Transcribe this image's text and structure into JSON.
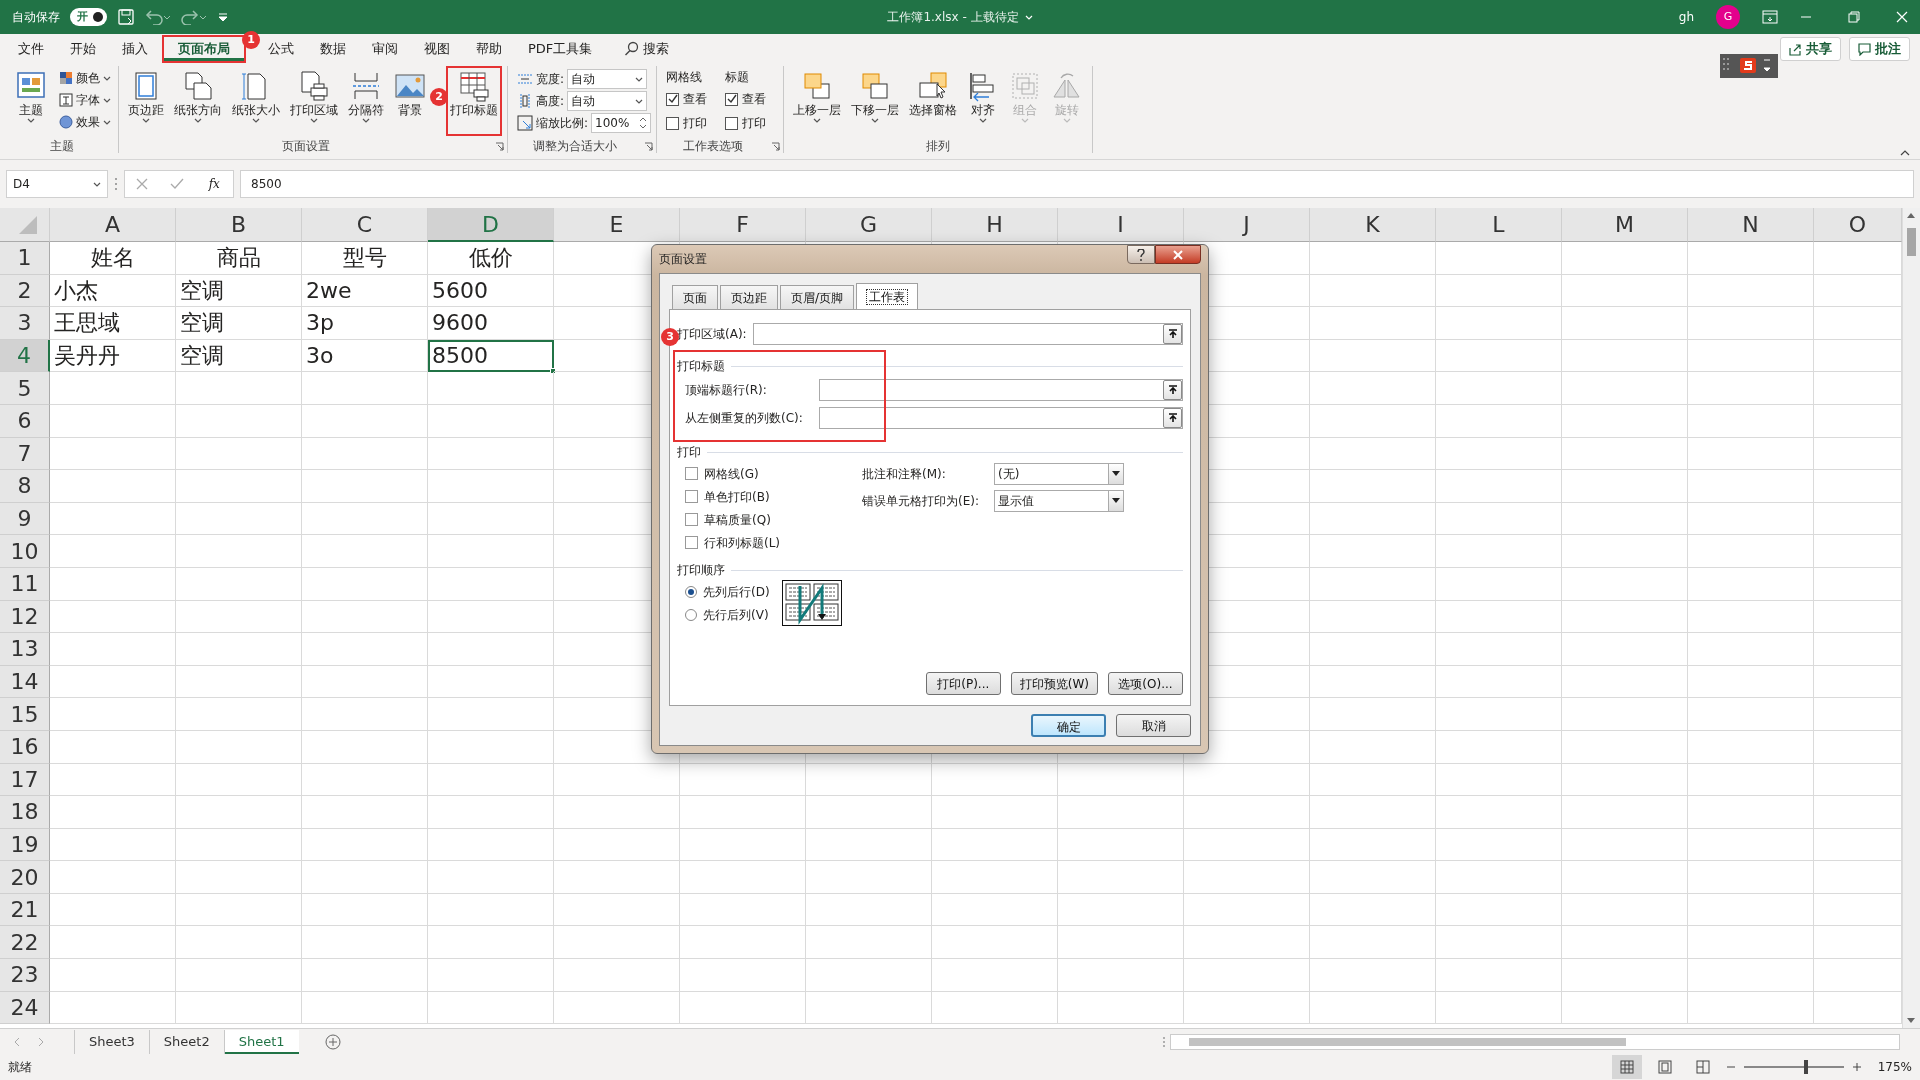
{
  "title_bar": {
    "autosave_label": "自动保存",
    "autosave_toggle": "开",
    "autosave_on": true,
    "document_title": "工作簿1.xlsx",
    "separator": "-",
    "upload_status": "上载待定",
    "user_name": "gh",
    "avatar_initial": "G"
  },
  "menu_tabs": [
    {
      "label": "文件",
      "selected": false
    },
    {
      "label": "开始",
      "selected": false
    },
    {
      "label": "插入",
      "selected": false
    },
    {
      "label": "页面布局",
      "selected": true,
      "callout": "1"
    },
    {
      "label": "公式",
      "selected": false
    },
    {
      "label": "数据",
      "selected": false
    },
    {
      "label": "审阅",
      "selected": false
    },
    {
      "label": "视图",
      "selected": false
    },
    {
      "label": "帮助",
      "selected": false
    },
    {
      "label": "PDF工具集",
      "selected": false
    }
  ],
  "search": {
    "label": "搜索"
  },
  "share_button": "共享",
  "comments_button": "批注",
  "ribbon": {
    "groups": [
      {
        "label": "主题",
        "launcher": false,
        "items": [
          {
            "kind": "large",
            "label": "主题",
            "caret": true,
            "disabled": false
          },
          {
            "kind": "small",
            "label": "颜色",
            "caret": true
          },
          {
            "kind": "small",
            "label": "字体",
            "caret": true
          },
          {
            "kind": "small",
            "label": "效果",
            "caret": true
          }
        ]
      },
      {
        "label": "页面设置",
        "launcher": true,
        "items": [
          {
            "kind": "large",
            "label": "页边距",
            "caret": true,
            "disabled": false
          },
          {
            "kind": "large",
            "label": "纸张方向",
            "caret": true,
            "disabled": false
          },
          {
            "kind": "large",
            "label": "纸张大小",
            "caret": true,
            "disabled": false
          },
          {
            "kind": "large",
            "label": "打印区域",
            "caret": true,
            "disabled": false
          },
          {
            "kind": "large",
            "label": "分隔符",
            "caret": true,
            "disabled": false
          },
          {
            "kind": "large",
            "label": "背景",
            "caret": false,
            "disabled": false
          },
          {
            "kind": "large",
            "label": "打印标题",
            "caret": false,
            "disabled": false,
            "callout": "2"
          }
        ]
      },
      {
        "label": "调整为合适大小",
        "launcher": true,
        "items": [
          {
            "kind": "field",
            "label": "宽度:",
            "value": "自动"
          },
          {
            "kind": "field",
            "label": "高度:",
            "value": "自动"
          },
          {
            "kind": "spin",
            "label": "缩放比例:",
            "value": "100%"
          }
        ]
      },
      {
        "label": "工作表选项",
        "launcher": true,
        "items": [
          {
            "kind": "checkgroup",
            "label": "网格线",
            "options": [
              {
                "label": "查看",
                "checked": true
              },
              {
                "label": "打印",
                "checked": false
              }
            ]
          },
          {
            "kind": "checkgroup",
            "label": "标题",
            "options": [
              {
                "label": "查看",
                "checked": true
              },
              {
                "label": "打印",
                "checked": false
              }
            ]
          }
        ]
      },
      {
        "label": "排列",
        "launcher": false,
        "items": [
          {
            "kind": "large",
            "label": "上移一层",
            "caret": true,
            "disabled": false
          },
          {
            "kind": "large",
            "label": "下移一层",
            "caret": true,
            "disabled": false
          },
          {
            "kind": "large",
            "label": "选择窗格",
            "caret": false,
            "disabled": false
          },
          {
            "kind": "large",
            "label": "对齐",
            "caret": true,
            "disabled": false
          },
          {
            "kind": "large",
            "label": "组合",
            "caret": true,
            "disabled": true
          },
          {
            "kind": "large",
            "label": "旋转",
            "caret": true,
            "disabled": true
          }
        ]
      }
    ]
  },
  "formula_bar": {
    "name_box": "D4",
    "function_label": "fx",
    "value": "8500"
  },
  "sheet": {
    "columns": [
      {
        "label": "A"
      },
      {
        "label": "B"
      },
      {
        "label": "C"
      },
      {
        "label": "D"
      },
      {
        "label": "E"
      },
      {
        "label": "F"
      },
      {
        "label": "G"
      },
      {
        "label": "H"
      },
      {
        "label": "I"
      },
      {
        "label": "J"
      },
      {
        "label": "K"
      },
      {
        "label": "L"
      },
      {
        "label": "M"
      },
      {
        "label": "N"
      },
      {
        "label": "O"
      }
    ],
    "rows": [
      {
        "number": "1",
        "kind": "header",
        "cells": [
          {
            "text": "姓名",
            "selected": false
          },
          {
            "text": "商品",
            "selected": false
          },
          {
            "text": "型号",
            "selected": false
          },
          {
            "text": "低价",
            "selected": false
          }
        ]
      },
      {
        "number": "2",
        "kind": "data",
        "cells": [
          {
            "text": "小杰",
            "selected": false
          },
          {
            "text": "空调",
            "selected": false
          },
          {
            "text": "2we",
            "selected": false
          },
          {
            "text": "5600",
            "selected": false
          }
        ]
      },
      {
        "number": "3",
        "kind": "data",
        "cells": [
          {
            "text": "王思域",
            "selected": false
          },
          {
            "text": "空调",
            "selected": false
          },
          {
            "text": "3p",
            "selected": false
          },
          {
            "text": "9600",
            "selected": false
          }
        ]
      },
      {
        "number": "4",
        "kind": "data",
        "cells": [
          {
            "text": "吴丹丹",
            "selected": false
          },
          {
            "text": "空调",
            "selected": false
          },
          {
            "text": "3o",
            "selected": false
          },
          {
            "text": "8500",
            "selected": true
          }
        ]
      },
      {
        "number": "5",
        "kind": "data"
      },
      {
        "number": "6",
        "kind": "data"
      },
      {
        "number": "7",
        "kind": "data"
      },
      {
        "number": "8",
        "kind": "data"
      },
      {
        "number": "9",
        "kind": "data"
      },
      {
        "number": "10",
        "kind": "data"
      },
      {
        "number": "11",
        "kind": "data"
      },
      {
        "number": "12",
        "kind": "data"
      },
      {
        "number": "13",
        "kind": "data"
      },
      {
        "number": "14",
        "kind": "data"
      },
      {
        "number": "15",
        "kind": "data"
      },
      {
        "number": "16",
        "kind": "data"
      },
      {
        "number": "17",
        "kind": "data"
      },
      {
        "number": "18",
        "kind": "data"
      },
      {
        "number": "19",
        "kind": "data"
      },
      {
        "number": "20",
        "kind": "data"
      },
      {
        "number": "21",
        "kind": "data"
      },
      {
        "number": "22",
        "kind": "data"
      },
      {
        "number": "23",
        "kind": "data"
      },
      {
        "number": "24",
        "kind": "data"
      }
    ]
  },
  "dialog": {
    "title": "页面设置",
    "tabs": [
      {
        "label": "页面",
        "selected": false
      },
      {
        "label": "页边距",
        "selected": false
      },
      {
        "label": "页眉/页脚",
        "selected": false
      },
      {
        "label": "工作表",
        "selected": true
      }
    ],
    "print_area": {
      "label": "打印区域(A):"
    },
    "print_titles": {
      "heading": "打印标题",
      "callout": "3",
      "fields": [
        {
          "label": "顶端标题行(R):"
        },
        {
          "label": "从左侧重复的列数(C):"
        }
      ]
    },
    "print": {
      "heading": "打印",
      "options": [
        {
          "label": "网格线(G)",
          "checked": false
        },
        {
          "label": "单色打印(B)",
          "checked": false
        },
        {
          "label": "草稿质量(Q)",
          "checked": false
        },
        {
          "label": "行和列标题(L)",
          "checked": false
        }
      ],
      "selects": [
        {
          "label": "批注和注释(M):",
          "value": "(无)"
        },
        {
          "label": "错误单元格打印为(E):",
          "value": "显示值"
        }
      ]
    },
    "page_order": {
      "heading": "打印顺序",
      "options": [
        {
          "label": "先列后行(D)",
          "selected": true
        },
        {
          "label": "先行后列(V)",
          "selected": false
        }
      ]
    },
    "action_buttons": [
      "打印(P)...",
      "打印预览(W)",
      "选项(O)..."
    ],
    "footer_buttons": [
      {
        "label": "确定",
        "default": true
      },
      {
        "label": "取消",
        "default": false
      }
    ]
  },
  "sheet_tabs": [
    {
      "label": "Sheet3",
      "selected": false
    },
    {
      "label": "Sheet2",
      "selected": false
    },
    {
      "label": "Sheet1",
      "selected": true
    }
  ],
  "status_bar": {
    "status": "就绪",
    "views": [
      {
        "selected": true
      },
      {
        "selected": false
      },
      {
        "selected": false
      }
    ],
    "zoom": {
      "level": 0.62,
      "reading": "175%"
    }
  }
}
